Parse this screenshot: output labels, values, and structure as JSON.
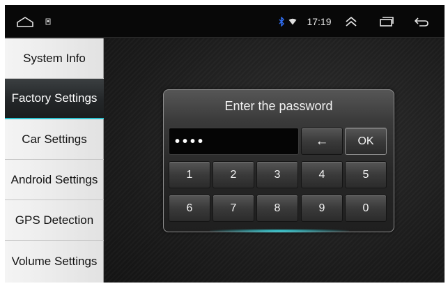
{
  "status_bar": {
    "time": "17:19",
    "icons": [
      "home-icon",
      "small-app-icon",
      "bluetooth-icon",
      "wifi-icon",
      "collapse-icon",
      "recent-apps-icon",
      "back-icon"
    ]
  },
  "sidebar": {
    "items": [
      {
        "label": "System Info",
        "active": false
      },
      {
        "label": "Factory Settings",
        "active": true
      },
      {
        "label": "Car Settings",
        "active": false
      },
      {
        "label": "Android Settings",
        "active": false
      },
      {
        "label": "GPS Detection",
        "active": false
      },
      {
        "label": "Volume Settings",
        "active": false
      }
    ]
  },
  "dialog": {
    "title": "Enter the password",
    "password_value": "••••",
    "backspace_label": "←",
    "ok_label": "OK",
    "keys_row1": [
      "1",
      "2",
      "3",
      "4",
      "5"
    ],
    "keys_row2": [
      "6",
      "7",
      "8",
      "9",
      "0"
    ]
  },
  "colors": {
    "accent": "#2ec3d0",
    "background": "#1a1a1a",
    "sidebar_bg": "#eeeeee",
    "active_item_bg": "#2a2d2f"
  }
}
